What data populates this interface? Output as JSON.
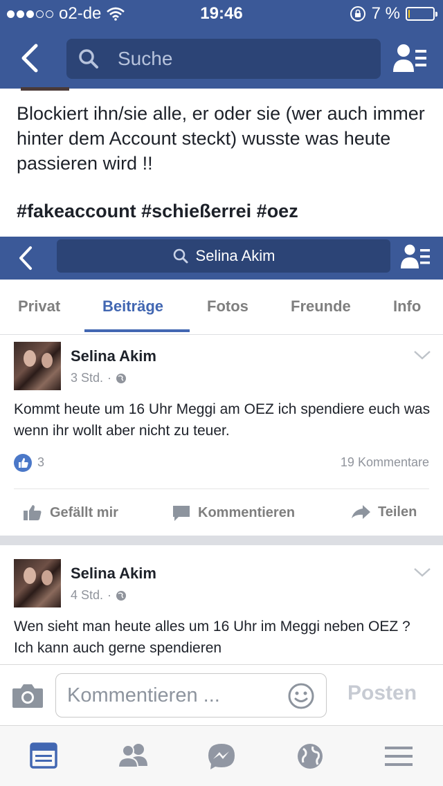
{
  "status_bar": {
    "carrier": "o2-de",
    "time": "19:46",
    "battery_percent": "7 %",
    "battery_level": 0.07,
    "signal_bars_filled": 3,
    "signal_bars_total": 5
  },
  "top_nav": {
    "search_placeholder": "Suche",
    "icons": {
      "back": "back-chevron-icon",
      "search": "search-icon",
      "friends": "friend-requests-icon"
    }
  },
  "post": {
    "text": "Blockiert ihn/sie alle, er oder sie (wer auch immer hinter dem Account steckt) wusste was heute passieren wird !!",
    "hashtags": "#fakeaccount  #schießerrei #oez"
  },
  "screenshot": {
    "nav": {
      "search_text": "Selina Akim"
    },
    "tabs": [
      {
        "label": "Privat",
        "active": false
      },
      {
        "label": "Beiträge",
        "active": true
      },
      {
        "label": "Fotos",
        "active": false
      },
      {
        "label": "Freunde",
        "active": false
      },
      {
        "label": "Info",
        "active": false
      }
    ],
    "posts": [
      {
        "author": "Selina Akim",
        "time": "3 Std.",
        "text": "Kommt heute um 16 Uhr Meggi am OEZ ich spendiere euch was wenn ihr wollt aber nicht zu teuer.",
        "likes": "3",
        "comments": "19 Kommentare"
      },
      {
        "author": "Selina Akim",
        "time": "4 Std.",
        "text": "Wen sieht man heute alles um 16 Uhr im Meggi neben OEZ ? Ich kann auch gerne spendieren"
      }
    ],
    "actions": {
      "like": "Gefällt mir",
      "comment": "Kommentieren",
      "share": "Teilen"
    }
  },
  "composer": {
    "placeholder": "Kommentieren ...",
    "post_button": "Posten"
  },
  "tab_bar": {
    "icons": [
      "news-feed-icon",
      "friends-icon",
      "messenger-icon",
      "globe-notifications-icon",
      "menu-icon"
    ]
  },
  "colors": {
    "brand": "#3b5998",
    "accent": "#4267b2",
    "battery_low": "#f5c518"
  }
}
